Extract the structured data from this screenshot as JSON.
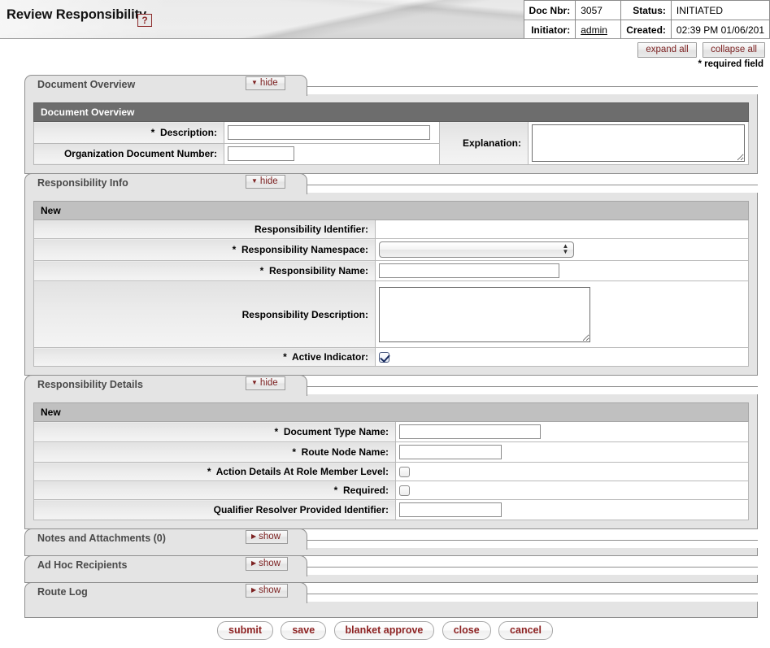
{
  "banner": {
    "title": "Review Responsibility",
    "help_icon_label": "?"
  },
  "doc_info": {
    "rows": [
      {
        "label1": "Doc Nbr:",
        "value1": "3057",
        "label2": "Status:",
        "value2": "INITIATED"
      },
      {
        "label1": "Initiator:",
        "value1": "admin",
        "label2": "Created:",
        "value2": "02:39 PM 01/06/201"
      }
    ]
  },
  "toolbar": {
    "expand_all": "expand all",
    "collapse_all": "collapse all",
    "required_note": "* required field"
  },
  "labels": {
    "hide": "hide",
    "show": "show",
    "hide_tri": "▼",
    "show_tri": "▶"
  },
  "sections": [
    {
      "tab_title": "Document Overview",
      "toggle": "hide",
      "table_header": "Document Overview",
      "header_style": "dark",
      "rows": [
        {
          "required": true,
          "label": "Description:",
          "field": "text-wide"
        },
        {
          "required": false,
          "label": "Organization Document Number:",
          "field": "text-short"
        }
      ],
      "right_label": "Explanation:",
      "right_field": "textarea"
    },
    {
      "tab_title": "Responsibility Info",
      "toggle": "hide",
      "table_header": "New",
      "header_style": "light",
      "rows": [
        {
          "required": false,
          "label": "Responsibility Identifier:",
          "field": "none"
        },
        {
          "required": true,
          "label": "Responsibility Namespace:",
          "field": "select"
        },
        {
          "required": true,
          "label": "Responsibility Name:",
          "field": "text-med"
        },
        {
          "required": false,
          "label": "Responsibility Description:",
          "field": "textarea-big"
        },
        {
          "required": true,
          "label": "Active Indicator:",
          "field": "checkbox-checked"
        }
      ]
    },
    {
      "tab_title": "Responsibility Details",
      "toggle": "hide",
      "table_header": "New",
      "header_style": "light",
      "rows": [
        {
          "required": true,
          "label": "Document Type Name:",
          "field": "text-med"
        },
        {
          "required": true,
          "label": "Route Node Name:",
          "field": "text-short2"
        },
        {
          "required": true,
          "label": "Action Details At Role Member Level:",
          "field": "checkbox"
        },
        {
          "required": true,
          "label": "Required:",
          "field": "checkbox"
        },
        {
          "required": false,
          "label": "Qualifier Resolver Provided Identifier:",
          "field": "text-short2"
        }
      ]
    }
  ],
  "collapsed_sections": [
    {
      "tab_title": "Notes and Attachments (0)",
      "toggle": "show"
    },
    {
      "tab_title": "Ad Hoc Recipients",
      "toggle": "show"
    },
    {
      "tab_title": "Route Log",
      "toggle": "show"
    }
  ],
  "actions": [
    {
      "label": "submit"
    },
    {
      "label": "save"
    },
    {
      "label": "blanket approve"
    },
    {
      "label": "close"
    },
    {
      "label": "cancel"
    }
  ],
  "select_options": {
    "namespace_selected": ""
  }
}
